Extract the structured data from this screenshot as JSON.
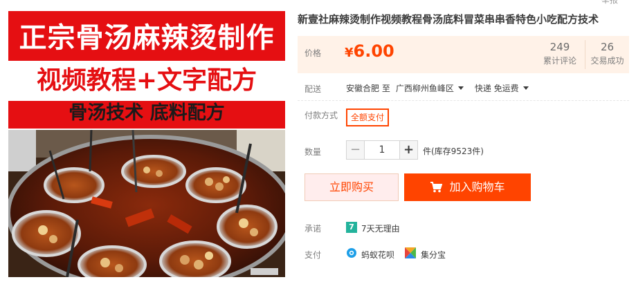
{
  "image": {
    "banner_line1": "正宗骨汤麻辣烫制作",
    "banner_line2": "视频教程+文字配方",
    "banner_line3": "骨汤技术 底料配方"
  },
  "top_cut_text": "举报",
  "title": "新壹社麻辣烫制作视频教程骨汤底料冒菜串串香特色小吃配方技术",
  "price": {
    "label": "价格",
    "currency": "¥",
    "value": "6.00",
    "color": "#ff4400"
  },
  "stats": [
    {
      "number": "249",
      "label": "累计评论"
    },
    {
      "number": "26",
      "label": "交易成功"
    }
  ],
  "delivery": {
    "label": "配送",
    "from": "安徽合肥 至",
    "to": "广西柳州鱼峰区",
    "method": "快递 免运费"
  },
  "payment_method": {
    "label": "付款方式",
    "option": "全额支付"
  },
  "quantity": {
    "label": "数量",
    "value": "1",
    "minus": "−",
    "plus": "+",
    "stock": "件(库存9523件)"
  },
  "buttons": {
    "buy_now": "立即购买",
    "add_cart": "加入购物车"
  },
  "promise": {
    "label": "承诺",
    "icon_text": "7",
    "text": "7天无理由"
  },
  "pay": {
    "label": "支付",
    "methods": [
      {
        "icon": "huabei-icon",
        "text": "蚂蚁花呗"
      },
      {
        "icon": "jifenbao-icon",
        "text": "集分宝"
      }
    ]
  }
}
